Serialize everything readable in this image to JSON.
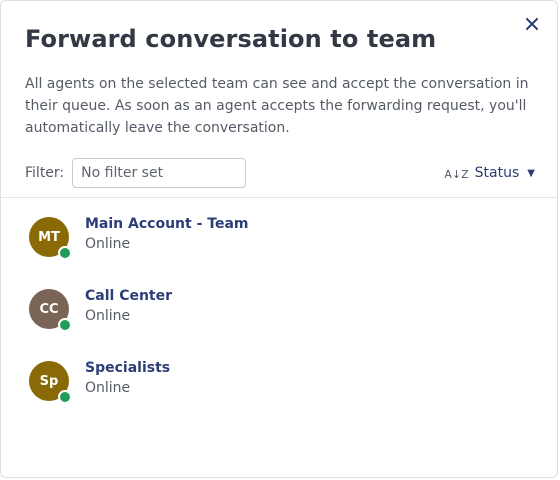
{
  "dialog": {
    "title": "Forward conversation to team",
    "description": "All agents on the selected team can see and accept the conversation in their queue. As soon as an agent accepts the forwarding request, you'll automatically leave the conversation.",
    "close_icon": "close-icon"
  },
  "filter": {
    "label": "Filter:",
    "placeholder": "No filter set",
    "value": ""
  },
  "sort": {
    "icon": "sort-az-icon",
    "label": "Status",
    "caret_icon": "caret-down-icon"
  },
  "teams": [
    {
      "initials": "MT",
      "name": "Main Account - Team",
      "status": "Online",
      "avatar_color": "#8a6a06",
      "status_color": "#1f9d55"
    },
    {
      "initials": "CC",
      "name": "Call Center",
      "status": "Online",
      "avatar_color": "#7a6455",
      "status_color": "#1f9d55"
    },
    {
      "initials": "Sp",
      "name": "Specialists",
      "status": "Online",
      "avatar_color": "#8a6a06",
      "status_color": "#1f9d55"
    }
  ],
  "colors": {
    "title": "#333845",
    "link": "#2c3e78",
    "online": "#1f9d55"
  }
}
